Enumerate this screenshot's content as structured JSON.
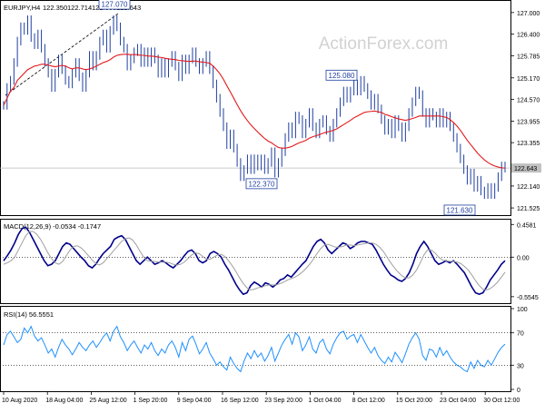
{
  "chart_data": [
    {
      "panel": "price",
      "type": "line",
      "title": "EURJPY,H4",
      "ohlc": [
        "122.350",
        "122.714",
        "121.965",
        "122.643"
      ],
      "watermark": "ActionForex.com",
      "ylim": [
        121.4,
        127.25
      ],
      "y_ticks": [
        "127.000",
        "126.400",
        "125.785",
        "125.170",
        "124.570",
        "123.955",
        "123.355",
        "122.140",
        "121.525"
      ],
      "current_price": "122.643",
      "x_tick_labels": [
        "10 Aug 2020",
        "18 Aug 04:00",
        "25 Aug 12:00",
        "1 Sep 20:00",
        "9 Sep 04:00",
        "16 Sep 12:00",
        "23 Sep 20:00",
        "1 Oct 04:00",
        "8 Oct 12:00",
        "15 Oct 20:00",
        "23 Oct 04:00",
        "30 Oct 12:00"
      ],
      "annotations": [
        {
          "label": "127.070",
          "value": 127.07
        },
        {
          "label": "122.370",
          "value": 122.37
        },
        {
          "label": "125.080",
          "value": 125.08
        },
        {
          "label": "121.630",
          "value": 121.63
        }
      ],
      "series": [
        {
          "type": "bar",
          "color": "#1f3fa0",
          "values": [
            124.4,
            124.9,
            125.1,
            125.6,
            126.2,
            126.6,
            126.5,
            126.8,
            126.3,
            126.1,
            126.4,
            126.0,
            125.6,
            125.3,
            124.9,
            125.3,
            125.7,
            125.4,
            125.1,
            125.0,
            125.3,
            125.6,
            125.2,
            124.9,
            125.3,
            125.8,
            125.5,
            125.8,
            126.2,
            126.4,
            126.0,
            126.5,
            126.8,
            126.6,
            126.2,
            126.0,
            125.5,
            125.7,
            125.9,
            126.0,
            125.6,
            125.9,
            125.6,
            125.9,
            125.7,
            125.3,
            125.6,
            125.3,
            125.6,
            125.8,
            125.5,
            125.2,
            125.7,
            125.4,
            125.7,
            125.9,
            125.6,
            125.4,
            125.6,
            125.8,
            125.4,
            125.0,
            124.6,
            124.2,
            123.8,
            123.3,
            123.6,
            123.2,
            122.8,
            122.4,
            122.6,
            122.9,
            122.6,
            122.9,
            122.7,
            122.9,
            122.6,
            122.8,
            123.1,
            122.5,
            122.8,
            123.1,
            123.5,
            123.8,
            123.6,
            124.1,
            124.0,
            123.6,
            123.9,
            124.2,
            123.8,
            123.6,
            123.9,
            124.0,
            123.7,
            123.5,
            123.9,
            124.2,
            124.5,
            124.8,
            124.6,
            124.8,
            125.0,
            124.8,
            125.1,
            124.9,
            124.7,
            124.4,
            124.6,
            124.3,
            124.0,
            123.7,
            123.9,
            123.6,
            124.0,
            123.8,
            123.5,
            123.8,
            124.2,
            124.5,
            124.8,
            124.7,
            124.2,
            123.9,
            124.2,
            124.1,
            123.9,
            124.2,
            123.9,
            124.1,
            123.8,
            123.5,
            123.2,
            122.9,
            122.6,
            122.3,
            122.5,
            122.1,
            122.3,
            122.0,
            121.9,
            122.1,
            121.9,
            122.1,
            122.4,
            122.7,
            122.64
          ]
        },
        {
          "type": "line",
          "color": "#e31a1c",
          "values": [
            124.4,
            124.6,
            124.8,
            124.9,
            125.1,
            125.2,
            125.3,
            125.4,
            125.45,
            125.5,
            125.52,
            125.55,
            125.55,
            125.53,
            125.5,
            125.48,
            125.5,
            125.52,
            125.5,
            125.45,
            125.42,
            125.45,
            125.45,
            125.42,
            125.4,
            125.42,
            125.45,
            125.5,
            125.55,
            125.6,
            125.63,
            125.68,
            125.75,
            125.8,
            125.82,
            125.83,
            125.83,
            125.82,
            125.82,
            125.82,
            125.8,
            125.8,
            125.78,
            125.78,
            125.77,
            125.75,
            125.74,
            125.72,
            125.7,
            125.69,
            125.68,
            125.66,
            125.65,
            125.64,
            125.63,
            125.64,
            125.64,
            125.62,
            125.61,
            125.6,
            125.58,
            125.5,
            125.4,
            125.28,
            125.13,
            124.95,
            124.78,
            124.6,
            124.42,
            124.25,
            124.1,
            123.97,
            123.85,
            123.75,
            123.65,
            123.56,
            123.47,
            123.4,
            123.35,
            123.28,
            123.22,
            123.2,
            123.2,
            123.22,
            123.25,
            123.3,
            123.35,
            123.38,
            123.42,
            123.48,
            123.52,
            123.55,
            123.58,
            123.62,
            123.65,
            123.67,
            123.7,
            123.74,
            123.8,
            123.86,
            123.92,
            123.98,
            124.05,
            124.1,
            124.15,
            124.2,
            124.22,
            124.23,
            124.24,
            124.22,
            124.2,
            124.15,
            124.12,
            124.08,
            124.05,
            124.02,
            124.0,
            123.98,
            124.0,
            124.03,
            124.06,
            124.1,
            124.1,
            124.1,
            124.1,
            124.1,
            124.1,
            124.1,
            124.08,
            124.06,
            124.0,
            123.92,
            123.82,
            123.7,
            123.56,
            123.42,
            123.3,
            123.18,
            123.06,
            122.96,
            122.87,
            122.8,
            122.74,
            122.7,
            122.67,
            122.65,
            122.64
          ]
        }
      ]
    },
    {
      "panel": "macd",
      "type": "line",
      "label": "MACD(12,26,9) -0.0534 -0.1747",
      "ylim": [
        -0.62,
        0.5
      ],
      "y_ticks": [
        "0.4581",
        "0.00",
        "-0.5545"
      ],
      "zero_line": true,
      "series": [
        {
          "type": "line",
          "color": "#00008b",
          "values": [
            -0.05,
            0.02,
            0.1,
            0.2,
            0.32,
            0.4,
            0.42,
            0.35,
            0.25,
            0.15,
            0.05,
            -0.05,
            -0.12,
            -0.1,
            -0.05,
            0.05,
            0.15,
            0.2,
            0.18,
            0.12,
            0.06,
            0.0,
            -0.05,
            -0.12,
            -0.15,
            -0.1,
            -0.02,
            0.05,
            0.1,
            0.15,
            0.25,
            0.28,
            0.3,
            0.25,
            0.15,
            0.05,
            -0.05,
            -0.1,
            -0.05,
            0.0,
            -0.05,
            -0.1,
            -0.08,
            -0.05,
            -0.08,
            -0.12,
            -0.15,
            -0.1,
            -0.05,
            0.02,
            0.08,
            0.1,
            0.05,
            -0.05,
            -0.08,
            -0.05,
            0.05,
            0.08,
            0.05,
            0.0,
            -0.1,
            -0.18,
            -0.28,
            -0.38,
            -0.46,
            -0.52,
            -0.5,
            -0.4,
            -0.35,
            -0.38,
            -0.42,
            -0.36,
            -0.38,
            -0.42,
            -0.38,
            -0.32,
            -0.3,
            -0.25,
            -0.28,
            -0.22,
            -0.16,
            -0.1,
            -0.05,
            0.05,
            0.15,
            0.22,
            0.25,
            0.2,
            0.1,
            0.05,
            0.1,
            0.15,
            0.2,
            0.18,
            0.12,
            0.15,
            0.2,
            0.22,
            0.22,
            0.2,
            0.18,
            0.1,
            0.0,
            -0.1,
            -0.18,
            -0.25,
            -0.28,
            -0.32,
            -0.34,
            -0.3,
            -0.22,
            -0.1,
            0.05,
            0.15,
            0.22,
            0.15,
            0.05,
            -0.05,
            -0.1,
            -0.08,
            -0.05,
            -0.08,
            -0.05,
            -0.1,
            -0.16,
            -0.22,
            -0.32,
            -0.42,
            -0.5,
            -0.52,
            -0.5,
            -0.42,
            -0.32,
            -0.25,
            -0.18,
            -0.1,
            -0.05
          ]
        },
        {
          "type": "line",
          "color": "#a0a0a0",
          "values": [
            -0.1,
            -0.08,
            -0.05,
            0.0,
            0.1,
            0.2,
            0.3,
            0.36,
            0.36,
            0.32,
            0.25,
            0.16,
            0.06,
            -0.02,
            -0.08,
            -0.1,
            -0.06,
            0.02,
            0.1,
            0.15,
            0.16,
            0.13,
            0.08,
            0.02,
            -0.04,
            -0.09,
            -0.11,
            -0.08,
            -0.02,
            0.04,
            0.1,
            0.16,
            0.22,
            0.26,
            0.27,
            0.24,
            0.17,
            0.08,
            0.0,
            -0.05,
            -0.06,
            -0.06,
            -0.07,
            -0.07,
            -0.07,
            -0.08,
            -0.1,
            -0.11,
            -0.1,
            -0.07,
            -0.02,
            0.03,
            0.06,
            0.05,
            0.01,
            -0.03,
            -0.03,
            0.0,
            0.03,
            0.04,
            0.01,
            -0.05,
            -0.12,
            -0.2,
            -0.29,
            -0.37,
            -0.43,
            -0.46,
            -0.45,
            -0.43,
            -0.42,
            -0.4,
            -0.39,
            -0.39,
            -0.39,
            -0.37,
            -0.35,
            -0.32,
            -0.3,
            -0.28,
            -0.25,
            -0.21,
            -0.16,
            -0.1,
            -0.03,
            0.05,
            0.12,
            0.17,
            0.18,
            0.16,
            0.14,
            0.14,
            0.15,
            0.17,
            0.17,
            0.16,
            0.17,
            0.18,
            0.19,
            0.2,
            0.2,
            0.18,
            0.14,
            0.08,
            0.0,
            -0.08,
            -0.15,
            -0.21,
            -0.26,
            -0.29,
            -0.29,
            -0.25,
            -0.18,
            -0.08,
            0.03,
            0.1,
            0.1,
            0.06,
            0.0,
            -0.04,
            -0.05,
            -0.06,
            -0.06,
            -0.07,
            -0.09,
            -0.13,
            -0.18,
            -0.25,
            -0.33,
            -0.4,
            -0.45,
            -0.46,
            -0.44,
            -0.4,
            -0.35,
            -0.28,
            -0.21
          ]
        }
      ]
    },
    {
      "panel": "rsi",
      "type": "line",
      "label": "RSI(14) 56.5551",
      "ylim": [
        0,
        100
      ],
      "y_ticks": [
        "100",
        "70",
        "30",
        "0"
      ],
      "levels": [
        70,
        30
      ],
      "series": [
        {
          "type": "line",
          "color": "#1e90ff",
          "values": [
            55,
            68,
            72,
            65,
            58,
            62,
            76,
            70,
            78,
            66,
            60,
            64,
            55,
            45,
            50,
            40,
            52,
            62,
            55,
            50,
            43,
            50,
            58,
            52,
            48,
            55,
            60,
            52,
            58,
            65,
            70,
            60,
            72,
            78,
            65,
            58,
            48,
            55,
            60,
            52,
            45,
            55,
            50,
            58,
            48,
            42,
            50,
            45,
            55,
            60,
            52,
            40,
            58,
            48,
            62,
            66,
            56,
            44,
            50,
            58,
            45,
            38,
            30,
            34,
            28,
            24,
            40,
            32,
            26,
            22,
            35,
            45,
            38,
            48,
            40,
            45,
            35,
            42,
            52,
            35,
            45,
            55,
            62,
            68,
            56,
            70,
            65,
            48,
            55,
            65,
            50,
            45,
            58,
            62,
            50,
            44,
            56,
            64,
            70,
            72,
            62,
            66,
            68,
            58,
            68,
            60,
            52,
            45,
            52,
            42,
            36,
            32,
            40,
            34,
            46,
            40,
            33,
            44,
            56,
            64,
            70,
            62,
            42,
            36,
            50,
            48,
            40,
            52,
            42,
            48,
            40,
            34,
            30,
            28,
            24,
            22,
            34,
            26,
            36,
            30,
            28,
            36,
            30,
            38,
            46,
            52,
            56
          ]
        }
      ]
    }
  ]
}
